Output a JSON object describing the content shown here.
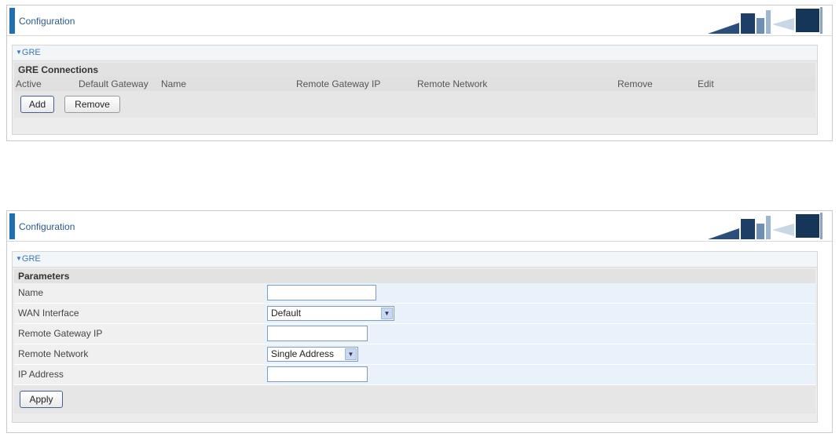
{
  "top": {
    "header_title": "Configuration",
    "section_title": "GRE",
    "connections_title": "GRE Connections",
    "columns": [
      "Active",
      "Default Gateway",
      "Name",
      "Remote Gateway IP",
      "Remote Network",
      "Remove",
      "Edit"
    ],
    "add_label": "Add",
    "remove_label": "Remove"
  },
  "bottom": {
    "header_title": "Configuration",
    "section_title": "GRE",
    "params_title": "Parameters",
    "fields": {
      "name_label": "Name",
      "name_value": "",
      "wan_label": "WAN Interface",
      "wan_value": "Default",
      "remote_gw_label": "Remote Gateway IP",
      "remote_gw_value": "",
      "remote_net_label": "Remote Network",
      "remote_net_value": "Single Address",
      "ip_label": "IP Address",
      "ip_value": ""
    },
    "apply_label": "Apply"
  },
  "colors": {
    "accent": "#1f6fb2",
    "section_link": "#3d78b8"
  },
  "icons": {
    "collapse": "triangle-down-icon",
    "dropdown": "chevron-down-icon",
    "logo": "office-illustration"
  }
}
